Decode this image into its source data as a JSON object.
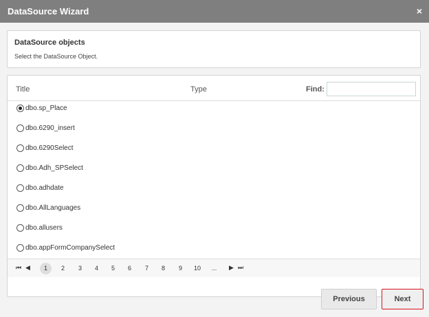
{
  "window": {
    "title": "DataSource Wizard",
    "close_glyph": "×"
  },
  "info": {
    "heading": "DataSource objects",
    "description": "Select the DataSource Object."
  },
  "grid": {
    "columns": {
      "title": "Title",
      "type": "Type"
    },
    "find_label": "Find:",
    "find_value": "",
    "rows": [
      {
        "label": "dbo.sp_Place",
        "selected": true
      },
      {
        "label": "dbo.6290_insert",
        "selected": false
      },
      {
        "label": "dbo.6290Select",
        "selected": false
      },
      {
        "label": "dbo.Adh_SPSelect",
        "selected": false
      },
      {
        "label": "dbo.adhdate",
        "selected": false
      },
      {
        "label": "dbo.AllLanguages",
        "selected": false
      },
      {
        "label": "dbo.allusers",
        "selected": false
      },
      {
        "label": "dbo.appFormCompanySelect",
        "selected": false
      }
    ]
  },
  "pager": {
    "first_glyph": "⏮",
    "prev_glyph": "◀",
    "next_glyph": "▶",
    "last_glyph": "⏭",
    "pages": [
      "1",
      "2",
      "3",
      "4",
      "5",
      "6",
      "7",
      "8",
      "9",
      "10",
      "..."
    ],
    "active_page": "1"
  },
  "buttons": {
    "previous": "Previous",
    "next": "Next"
  },
  "colors": {
    "titlebar": "#7f7f7f",
    "next_border": "#d8121b"
  }
}
